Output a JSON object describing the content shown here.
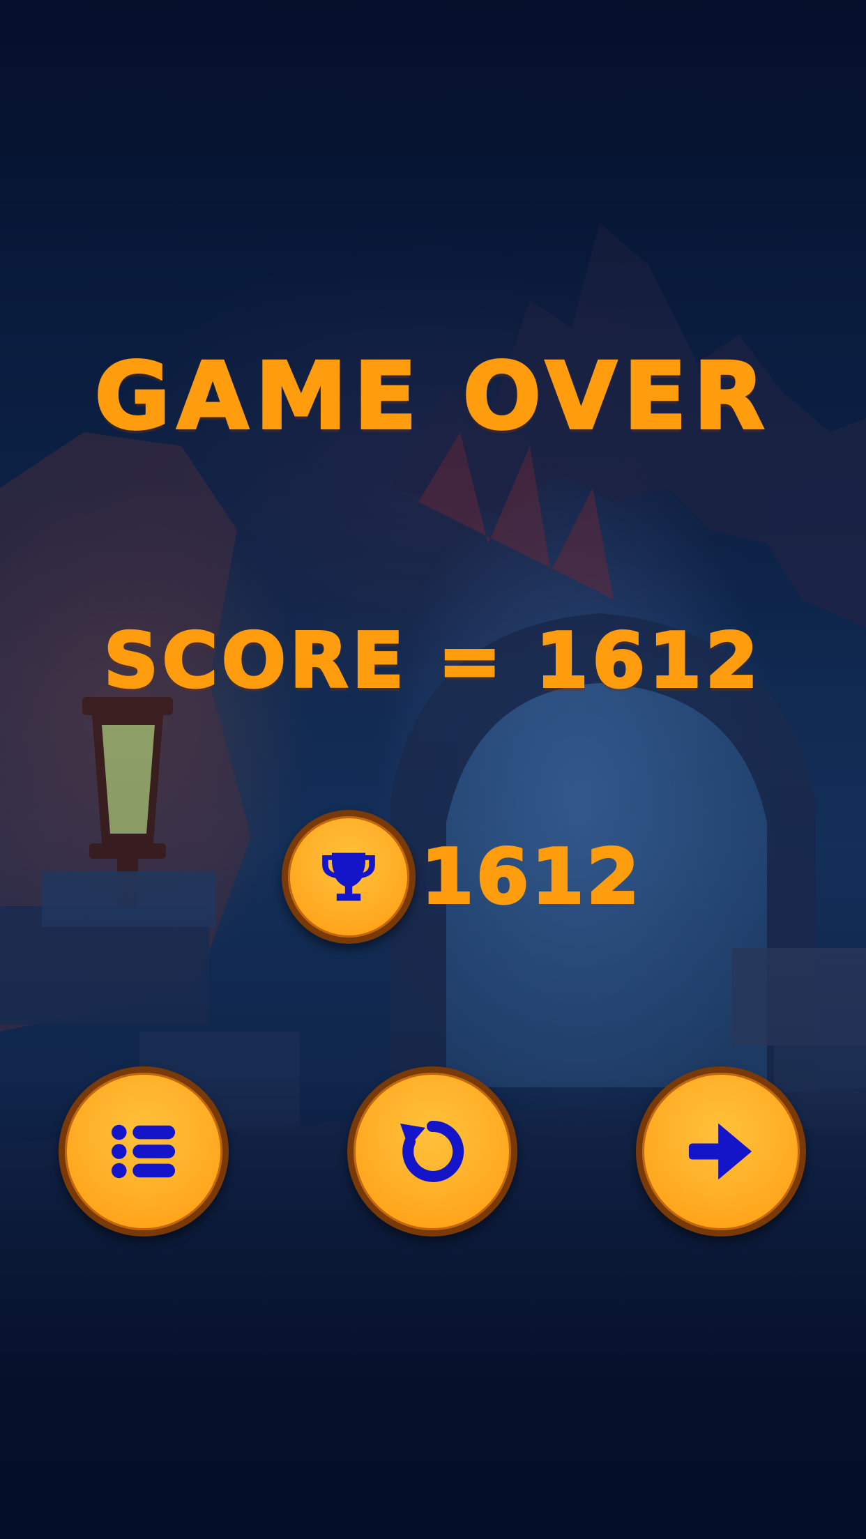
{
  "screen": {
    "title": "GAME OVER",
    "score_line": "SCORE = 1612",
    "best_score": "1612"
  },
  "icons": {
    "best": "trophy-icon",
    "menu": "list-icon",
    "replay": "replay-icon",
    "next": "arrow-right-icon"
  },
  "colors": {
    "text": "#ff9d0f",
    "button_fill": "#ffb12a",
    "button_border": "#7a3a08",
    "icon": "#1414c8",
    "background": "#0d2348"
  }
}
